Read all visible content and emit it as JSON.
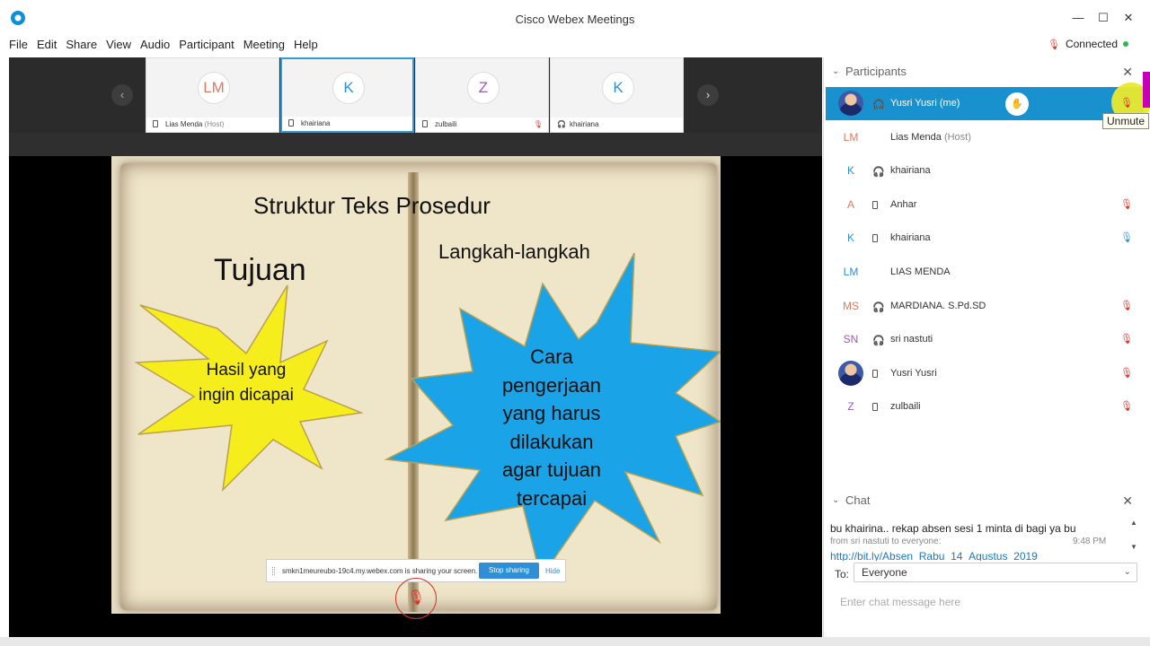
{
  "window": {
    "title": "Cisco Webex Meetings",
    "minimize": "—",
    "maximize": "☐",
    "close": "✕"
  },
  "menu": [
    "File",
    "Edit",
    "Share",
    "View",
    "Audio",
    "Participant",
    "Meeting",
    "Help"
  ],
  "status": {
    "mic_icon": "🎙",
    "label": "Connected"
  },
  "thumbnails": [
    {
      "initials": "LM",
      "name": "Lias Menda",
      "sub": "(Host)",
      "color": "#e07a5f"
    },
    {
      "initials": "K",
      "name": "khairiana",
      "sub": "",
      "color": "#2f8fd6"
    },
    {
      "initials": "Z",
      "name": "zulbaili",
      "sub": "",
      "color": "#9b59b6"
    },
    {
      "initials": "K",
      "name": "khairiana",
      "sub": "",
      "color": "#2f8fd6"
    }
  ],
  "nav": {
    "prev": "‹",
    "next": "›"
  },
  "slide": {
    "title": "Struktur Teks Prosedur",
    "left_heading": "Tujuan",
    "right_heading": "Langkah-langkah",
    "yellow_lines": [
      "Hasil yang",
      "ingin dicapai"
    ],
    "blue_lines": [
      "Cara",
      "pengerjaan",
      "yang harus",
      "dilakukan",
      "agar tujuan",
      "tercapai"
    ],
    "colors": {
      "yellow": "#f6ee1c",
      "blue": "#1aa3e6",
      "outline": "#b8a152"
    }
  },
  "share_bar": {
    "text": "smkn1meureubo-19c4.my.webex.com is sharing your screen.",
    "stop_label": "Stop sharing",
    "hide_label": "Hide"
  },
  "participants_panel": {
    "title": "Participants",
    "tooltip": "Unmute",
    "raise_icon": "✋",
    "list": [
      {
        "initials": "",
        "photo": true,
        "status": "headset",
        "name": "Yusri Yusri (me)",
        "sub": "",
        "mic": "muted",
        "selected": true
      },
      {
        "initials": "LM",
        "photo": false,
        "status": "",
        "name": "Lias Menda",
        "sub": "(Host)",
        "mic": "",
        "color": "#e07a5f"
      },
      {
        "initials": "K",
        "photo": false,
        "status": "headset",
        "name": "khairiana",
        "sub": "",
        "mic": "",
        "color": "#2f8fd6"
      },
      {
        "initials": "A",
        "photo": false,
        "status": "phone",
        "name": "Anhar",
        "sub": "",
        "mic": "muted",
        "color": "#e07a5f"
      },
      {
        "initials": "K",
        "photo": false,
        "status": "phone",
        "name": "khairiana",
        "sub": "",
        "mic": "on",
        "color": "#2f8fd6"
      },
      {
        "initials": "LM",
        "photo": false,
        "status": "",
        "name": "LIAS MENDA",
        "sub": "",
        "mic": "",
        "color": "#2f8fd6"
      },
      {
        "initials": "MS",
        "photo": false,
        "status": "headset",
        "name": "MARDIANA. S.Pd.SD",
        "sub": "",
        "mic": "muted",
        "color": "#e07a5f"
      },
      {
        "initials": "SN",
        "photo": false,
        "status": "headset",
        "name": "sri nastuti",
        "sub": "",
        "mic": "muted",
        "color": "#9b59b6"
      },
      {
        "initials": "",
        "photo": true,
        "status": "phone",
        "name": "Yusri Yusri",
        "sub": "",
        "mic": "muted"
      },
      {
        "initials": "Z",
        "photo": false,
        "status": "phone",
        "name": "zulbaili",
        "sub": "",
        "mic": "muted",
        "color": "#9b59b6"
      }
    ]
  },
  "chat": {
    "title": "Chat",
    "message": "bu khairina.. rekap absen sesi 1 minta di bagi ya bu",
    "from": "from sri nastuti to everyone:",
    "time": "9:48 PM",
    "link": "http://bit.ly/Absen_Rabu_14_Agustus_2019",
    "to_label": "To:",
    "to_value": "Everyone",
    "placeholder": "Enter chat message here"
  }
}
